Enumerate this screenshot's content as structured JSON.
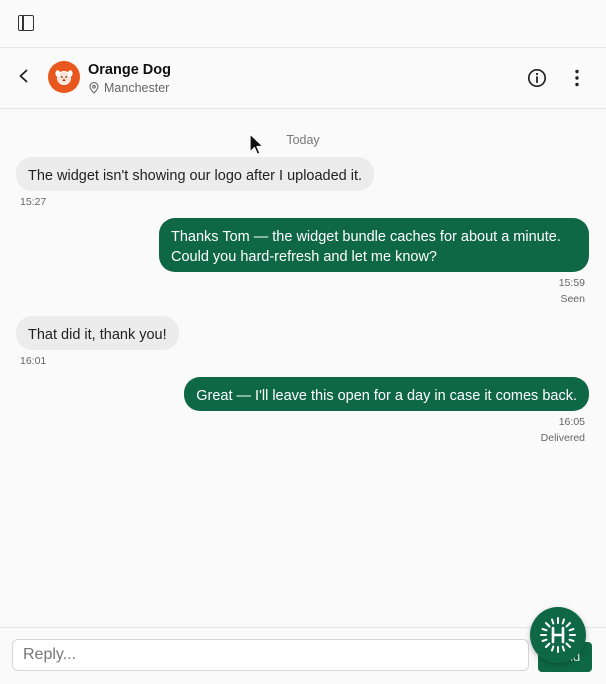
{
  "contact": {
    "name": "Orange Dog",
    "location": "Manchester"
  },
  "feed": {
    "day_label": "Today",
    "messages": [
      {
        "direction": "in",
        "text": "The widget isn't showing our logo after I uploaded it.",
        "time": "15:27",
        "status": ""
      },
      {
        "direction": "out",
        "text": "Thanks Tom — the widget bundle caches for about a minute. Could you hard-refresh and let me know?",
        "time": "15:59",
        "status": "Seen"
      },
      {
        "direction": "in",
        "text": "That did it, thank you!",
        "time": "16:01",
        "status": ""
      },
      {
        "direction": "out",
        "text": "Great — I'll leave this open for a day in case it comes back.",
        "time": "16:05",
        "status": "Delivered"
      }
    ]
  },
  "composer": {
    "placeholder": "Reply...",
    "send_label": "Send"
  },
  "colors": {
    "accent": "#0e6846",
    "avatar": "#e8571d"
  },
  "icons": {
    "sidebar_toggle": "sidebar-icon",
    "back": "chevron-left-icon",
    "location": "map-pin-icon",
    "info": "info-icon",
    "more": "more-vertical-icon",
    "launcher": "help-widget-icon"
  }
}
